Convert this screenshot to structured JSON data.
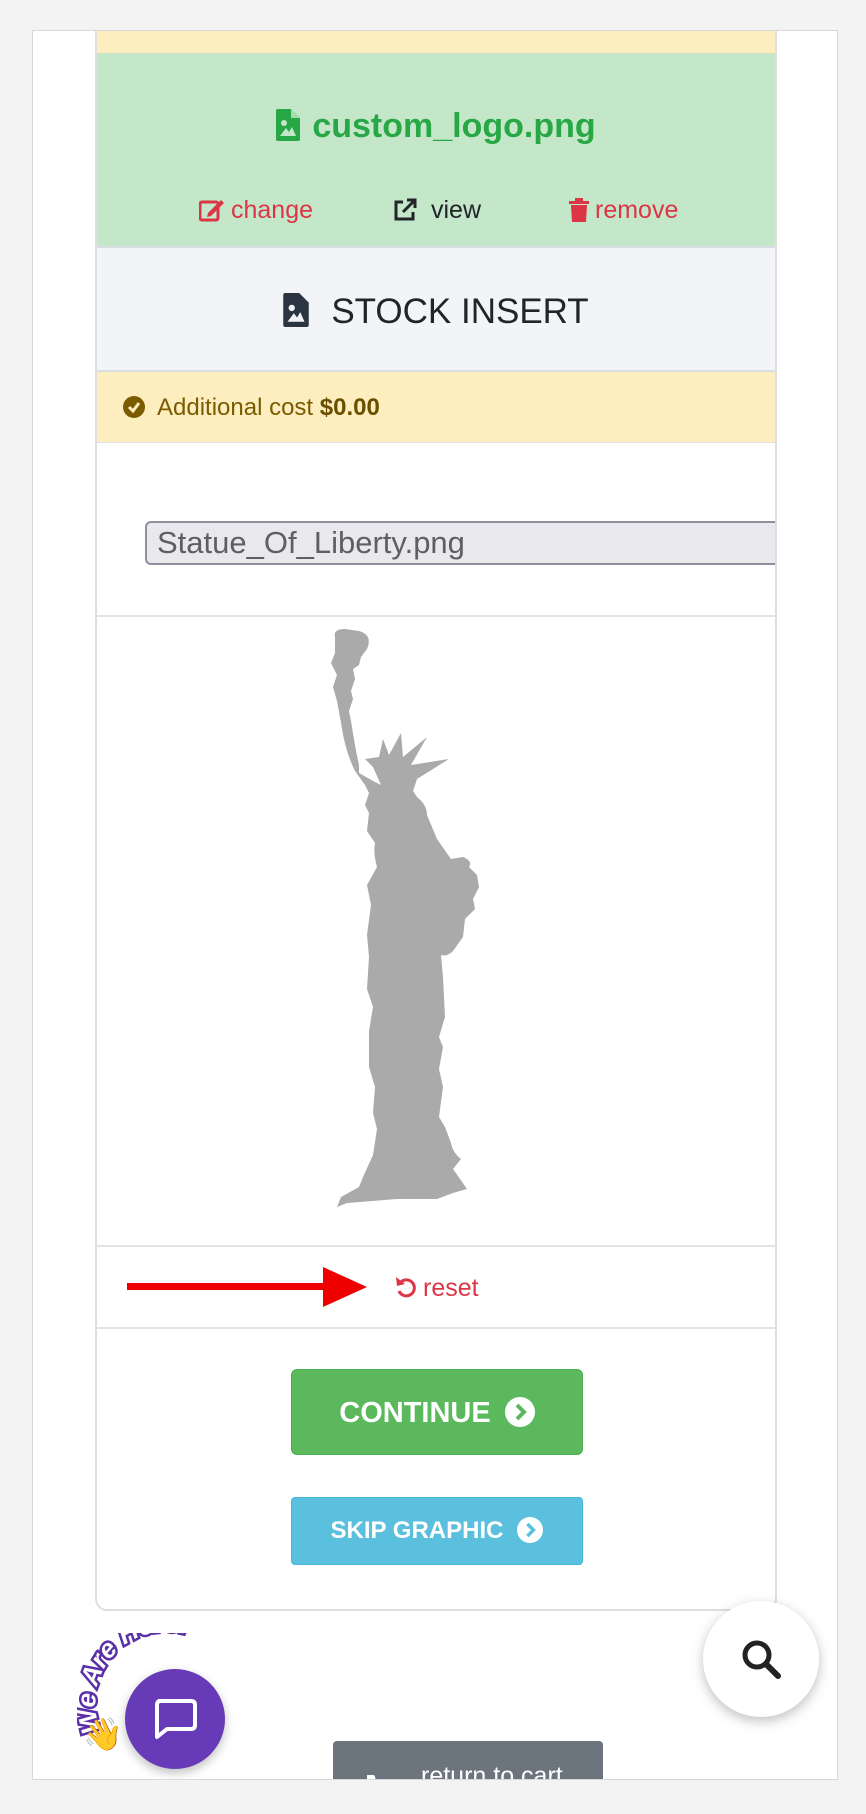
{
  "logo_file": {
    "name": "custom_logo.png",
    "actions": {
      "change": "change",
      "view": "view",
      "remove": "remove"
    }
  },
  "stock_insert": {
    "title": "STOCK INSERT"
  },
  "cost": {
    "label": "Additional cost",
    "amount": "$0.00"
  },
  "file_input": {
    "value": "Statue_Of_Liberty.png"
  },
  "preview": {
    "image": "statue-of-liberty-silhouette",
    "color": "#aaaaaa"
  },
  "reset": {
    "label": "reset"
  },
  "buttons": {
    "continue": "CONTINUE",
    "skip": "SKIP GRAPHIC"
  },
  "chat": {
    "badge_text": "We Are Here!"
  },
  "cart": {
    "label": "return to cart"
  },
  "colors": {
    "success": "#28a745",
    "danger": "#dc3545",
    "continue": "#5cb85c",
    "info": "#5bc0de",
    "chat": "#673ab7"
  }
}
